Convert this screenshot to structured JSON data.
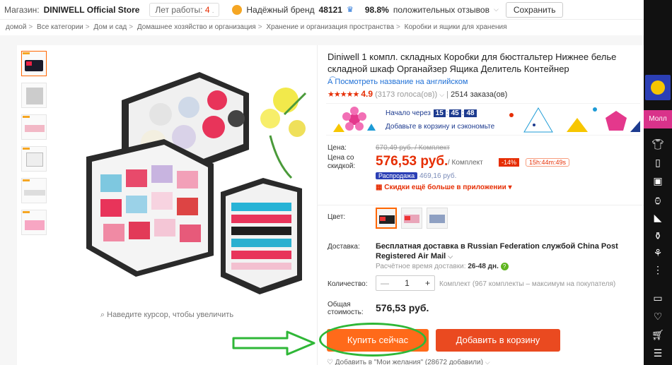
{
  "store_bar": {
    "store_label": "Магазин:",
    "store_name": "DINIWELL Official Store",
    "years_label": "Лет работы:",
    "years_value": "4",
    "brand_label": "Надёжный бренд",
    "followers": "48121",
    "feedback_percent": "98.8%",
    "feedback_label": "положительных отзывов",
    "save_label": "Сохранить"
  },
  "breadcrumb": [
    "домой",
    "Все категории",
    "Дом и сад",
    "Домашнее хозяйство и организация",
    "Хранение и организация пространства",
    "Коробки и ящики для хранения"
  ],
  "gallery": {
    "zoom_hint": "Наведите курсор, чтобы увеличить"
  },
  "product": {
    "title": "Diniwell 1 компл. складных Коробки для бюстгальтер Нижнее белье складной шкаф Органайзер Ящика Делитель Контейнер",
    "translate_link": "Посмотреть название на английском",
    "rating_score": "4.9",
    "rating_stars": 4.9,
    "votes": "(3173 голоса(ов))",
    "orders": "2514 заказа(ов)"
  },
  "promo": {
    "start_label": "Начало через",
    "timer": [
      "15",
      "45",
      "48"
    ],
    "add_label": "Добавьте в корзину и сэкономьте"
  },
  "price": {
    "price_label": "Цена:",
    "old_price": "670,49 руб. / Комплект",
    "discount_label_1": "Цена со",
    "discount_label_2": "скидкой:",
    "new_price": "576,53 руб.",
    "per_unit": "/ Комплект",
    "discount": "-14%",
    "countdown": "15h:44m:49s",
    "sale_badge": "Распродажа",
    "sale_price": "469,16 руб.",
    "app_discount": "Скидки ещё больше в приложении"
  },
  "options": {
    "color_label": "Цвет:",
    "shipping_label": "Доставка:",
    "shipping_text": "Бесплатная доставка в Russian Federation службой China Post Registered Air Mail",
    "shipping_time_label": "Расчётное время доставки:",
    "shipping_time_value": "26-48 дн.",
    "quantity_label": "Количество:",
    "quantity_value": "1",
    "quantity_note": "Комплект (967 комплекты – максимум на покупателя)",
    "total_label_1": "Общая",
    "total_label_2": "стоимость:",
    "total_value": "576,53 руб."
  },
  "actions": {
    "buy_now": "Купить сейчас",
    "add_to_cart": "Добавить в корзину",
    "wishlist": "Добавить в \"Мои желания\" (28672 добавили)"
  },
  "sidebar": {
    "mall_label": "Молл"
  },
  "colors": {
    "accent": "#ff6a1a",
    "price_red": "#e62e04",
    "highlight_green": "#2fb737",
    "link_blue": "#1d6fd6"
  }
}
